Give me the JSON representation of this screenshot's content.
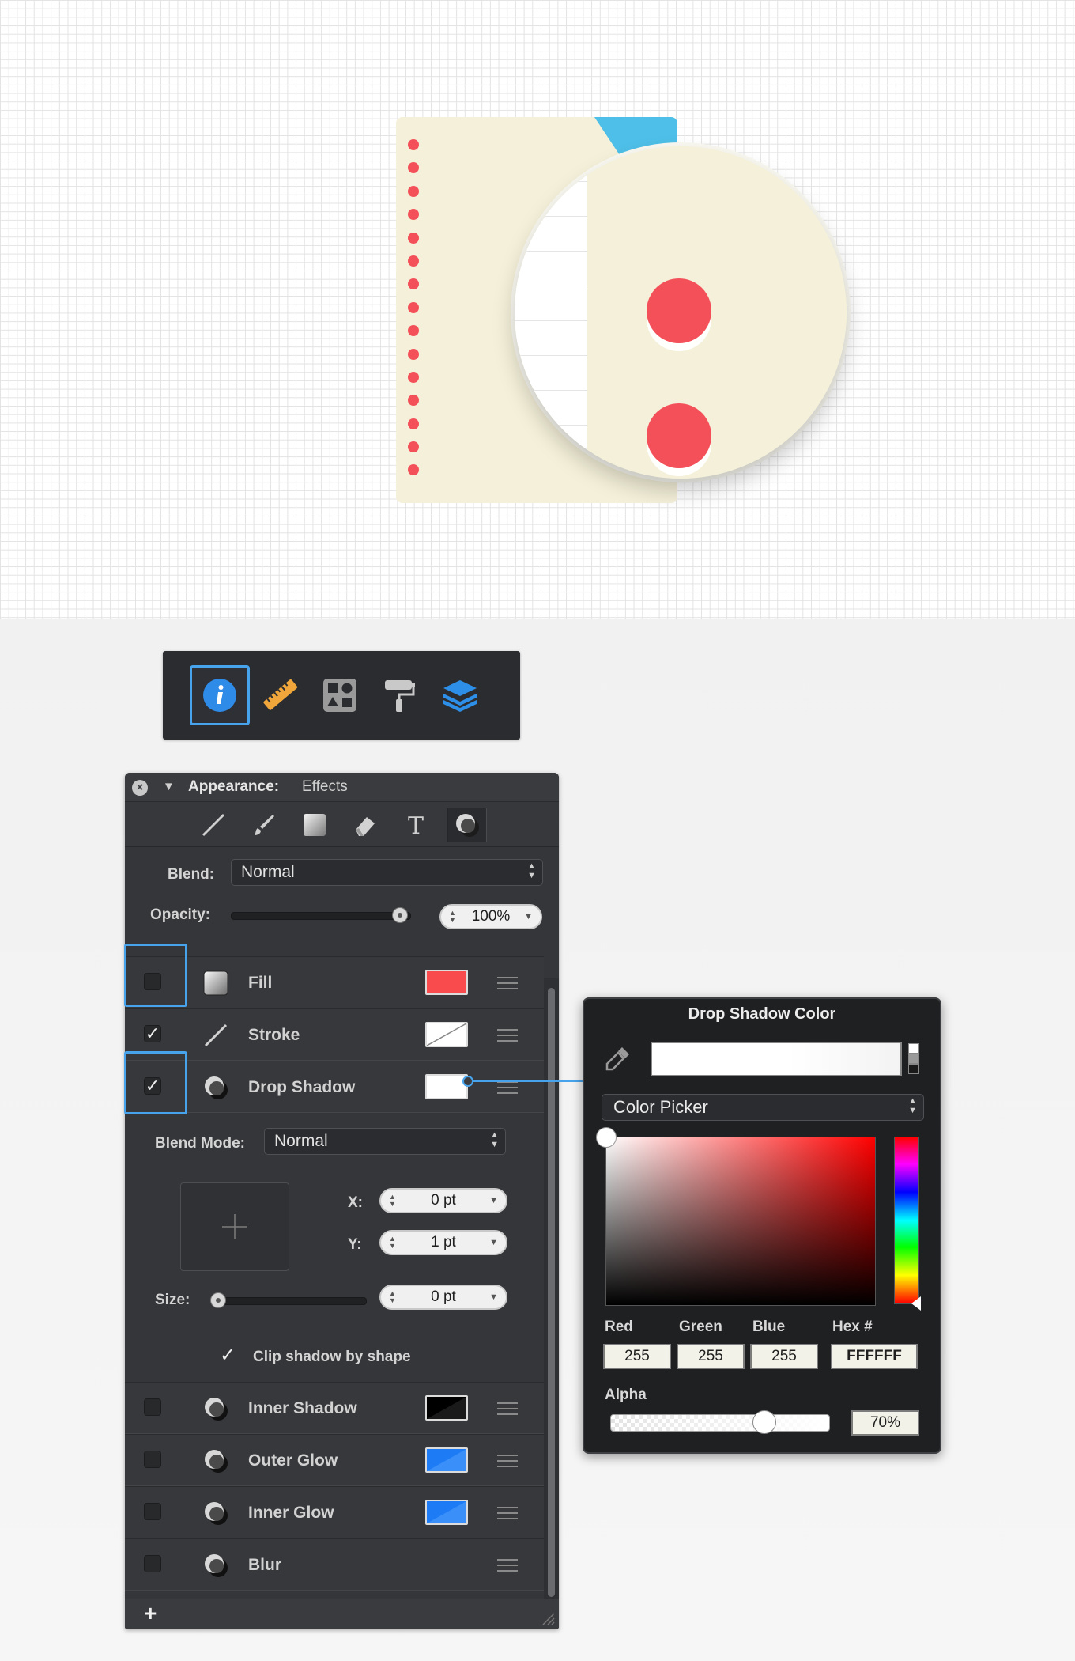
{
  "toolbar": {
    "buttons": [
      {
        "name": "info-icon",
        "active": true
      },
      {
        "name": "ruler-icon",
        "active": false
      },
      {
        "name": "shapes-icon",
        "active": false
      },
      {
        "name": "paint-roller-icon",
        "active": false
      },
      {
        "name": "layers-icon",
        "active": false
      }
    ]
  },
  "panel": {
    "title_section": "Appearance:",
    "title_sub": "Effects",
    "tabs": [
      "line-icon",
      "brush-icon",
      "gradient-square-icon",
      "eraser-icon",
      "text-icon",
      "effects-icon"
    ],
    "blend_label": "Blend:",
    "blend_value": "Normal",
    "opacity_label": "Opacity:",
    "opacity_value": "100%",
    "opacity_fraction": 1.0,
    "effects": [
      {
        "name": "Fill",
        "checked": false,
        "swatch": "#f94b4e"
      },
      {
        "name": "Stroke",
        "checked": true,
        "swatch": "none"
      },
      {
        "name": "Drop Shadow",
        "checked": true,
        "swatch": "#ffffff"
      }
    ],
    "shadow": {
      "blend_mode_label": "Blend Mode:",
      "blend_mode_value": "Normal",
      "x_label": "X:",
      "x_value": "0 pt",
      "y_label": "Y:",
      "y_value": "1 pt",
      "size_label": "Size:",
      "size_value": "0 pt",
      "clip_label": "Clip shadow by shape",
      "clip_checked": true
    },
    "more_effects": [
      {
        "name": "Inner Shadow",
        "checked": false,
        "swatch": "#000000"
      },
      {
        "name": "Outer Glow",
        "checked": false,
        "swatch": "#1d7bf5"
      },
      {
        "name": "Inner Glow",
        "checked": false,
        "swatch": "#1d7bf5"
      },
      {
        "name": "Blur",
        "checked": false,
        "swatch": ""
      }
    ],
    "add_label": "+"
  },
  "color_popover": {
    "title": "Drop Shadow Color",
    "mode_value": "Color Picker",
    "red_label": "Red",
    "green_label": "Green",
    "blue_label": "Blue",
    "hex_label": "Hex #",
    "red": "255",
    "green": "255",
    "blue": "255",
    "hex": "FFFFFF",
    "alpha_label": "Alpha",
    "alpha_value": "70%",
    "alpha_fraction": 0.7,
    "hue_color": "#ff0000"
  },
  "colors": {
    "accent": "#47a4ec",
    "note": "#f4f0d9",
    "dot_red": "#f4505a",
    "tab_blue": "#4ebfe8"
  }
}
